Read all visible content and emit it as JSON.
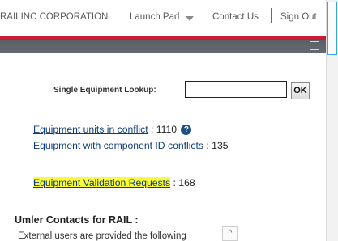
{
  "nav": {
    "company": "RAILINC CORPORATION",
    "launch_pad": "Launch Pad",
    "contact_us": "Contact Us",
    "sign_out": "Sign Out"
  },
  "lookup": {
    "label": "Single Equipment Lookup:",
    "value": "",
    "ok_label": "OK"
  },
  "stats": {
    "conflict_link": "Equipment units in conflict",
    "conflict_count": ": 1110",
    "help_glyph": "?",
    "component_link": "Equipment with component ID conflicts",
    "component_count": ": 135",
    "validation_link": "Equipment Validation Requests",
    "validation_count": ": 168"
  },
  "contacts": {
    "heading": "Umler Contacts for  RAIL :",
    "text": "External users are provided the following",
    "scroll_up_glyph": "^"
  },
  "colors": {
    "brand_red": "#c91d35",
    "bar_gray": "#5f656a",
    "link_blue": "#0e3c78",
    "highlight": "#fafb3a"
  },
  "icons": [
    "dropdown-caret-icon",
    "help-icon",
    "window-icon",
    "scroll-up-icon"
  ]
}
